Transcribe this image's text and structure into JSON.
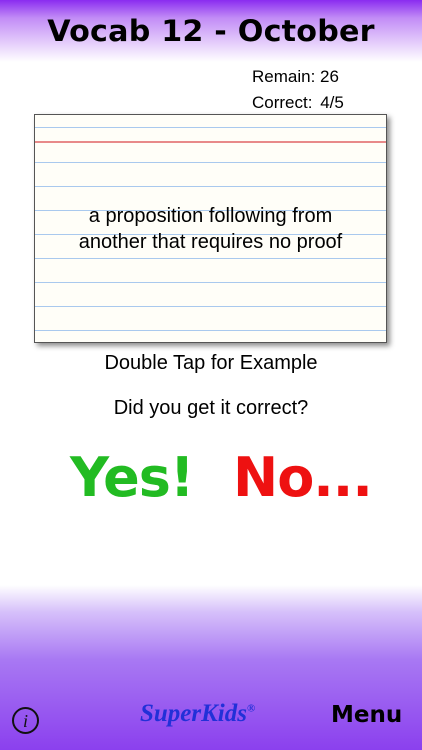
{
  "header": {
    "title": "Vocab 12 - October"
  },
  "stats": {
    "remain_label": "Remain:",
    "remain_value": "26",
    "correct_label": "Correct:",
    "correct_value": "4/5"
  },
  "card": {
    "line1": "a proposition following from",
    "line2": "another that requires no proof"
  },
  "hint": "Double Tap for Example",
  "question": "Did you get it correct?",
  "answers": {
    "yes": "Yes!",
    "no": "No..."
  },
  "footer": {
    "info_glyph": "i",
    "logo": "SuperKids",
    "logo_mark": "®",
    "menu": "Menu"
  },
  "colors": {
    "gradient_purple": "#8b40ee",
    "yes_green": "#22bb22",
    "no_red": "#ee1111",
    "logo_blue": "#2230d8"
  }
}
